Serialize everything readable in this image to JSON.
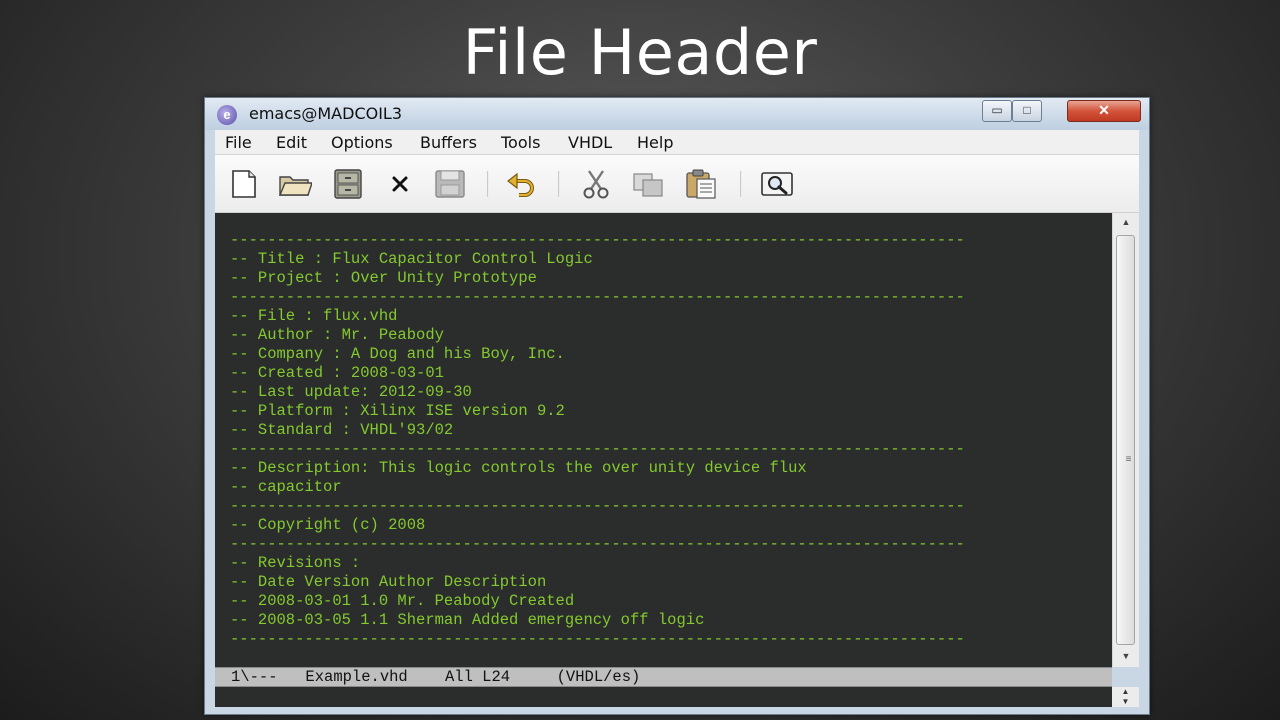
{
  "slide": {
    "title": "File Header"
  },
  "window": {
    "title": "emacs@MADCOIL3",
    "controls": {
      "minimize": "▭",
      "maximize": "□",
      "close": "✕"
    }
  },
  "menu": [
    "File",
    "Edit",
    "Options",
    "Buffers",
    "Tools",
    "VHDL",
    "Help"
  ],
  "toolbar_icons": [
    "new-file-icon",
    "open-folder-icon",
    "dired-cabinet-icon",
    "close-buffer-icon",
    "save-icon",
    "undo-icon",
    "cut-icon",
    "copy-icon",
    "paste-icon",
    "search-icon"
  ],
  "editor": {
    "text_color": "#84c92f",
    "background": "#2a2d2c",
    "lines": [
      "-------------------------------------------------------------------------------",
      "-- Title : Flux Capacitor Control Logic",
      "-- Project : Over Unity Prototype",
      "-------------------------------------------------------------------------------",
      "-- File : flux.vhd",
      "-- Author : Mr. Peabody",
      "-- Company : A Dog and his Boy, Inc.",
      "-- Created : 2008-03-01",
      "-- Last update: 2012-09-30",
      "-- Platform : Xilinx ISE version 9.2",
      "-- Standard : VHDL'93/02",
      "-------------------------------------------------------------------------------",
      "-- Description: This logic controls the over unity device flux",
      "-- capacitor",
      "-------------------------------------------------------------------------------",
      "-- Copyright (c) 2008",
      "-------------------------------------------------------------------------------",
      "-- Revisions :",
      "-- Date Version Author Description",
      "-- 2008-03-01 1.0 Mr. Peabody Created",
      "-- 2008-03-05 1.1 Sherman Added emergency off logic",
      "-------------------------------------------------------------------------------"
    ]
  },
  "modeline": {
    "status": "1\\---",
    "buffer": "Example.vhd",
    "position": "All L24",
    "mode": "(VHDL/es)"
  }
}
